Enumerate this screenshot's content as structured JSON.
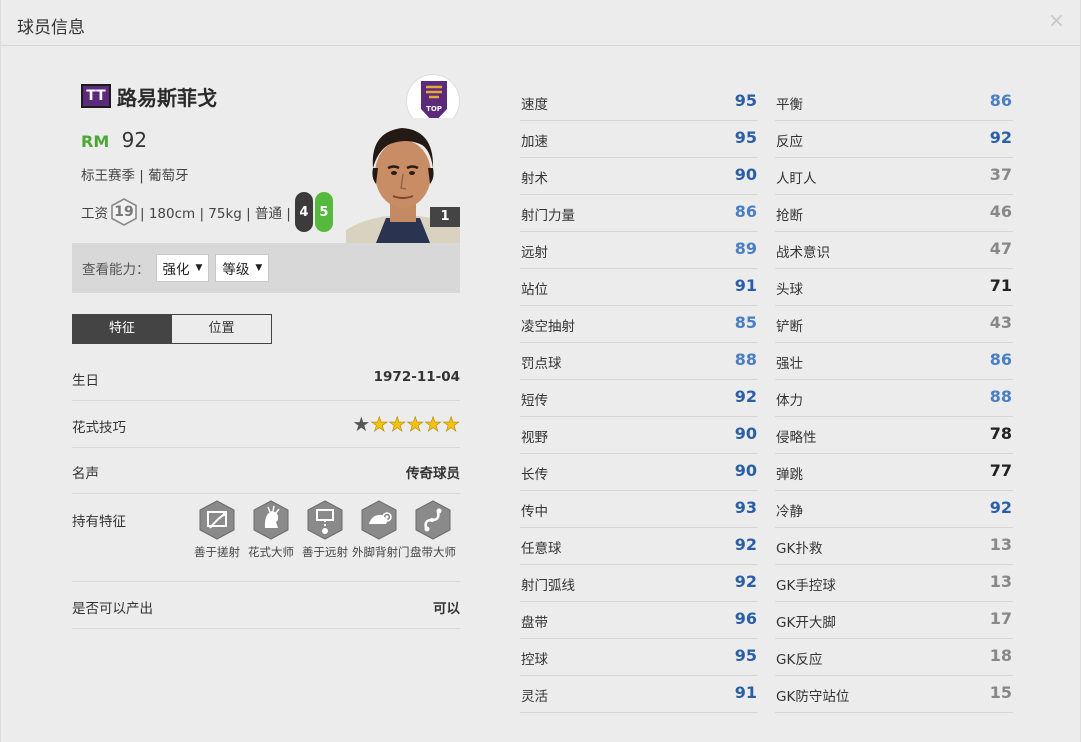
{
  "window": {
    "title": "球员信息",
    "close": "×"
  },
  "player": {
    "tag": "TT",
    "name": "路易斯菲戈",
    "position": "RM",
    "overall": "92",
    "season_nation": "标王赛季 | 葡萄牙",
    "salary_label": "工资",
    "salary": "19",
    "body": "| 180cm | 75kg | 普通 |",
    "weak_foot_left": "4",
    "weak_foot_right": "5",
    "card_level": "1",
    "club_logo_text": "TOP"
  },
  "ability": {
    "label": "查看能力：",
    "enhance": "强化",
    "level": "等级"
  },
  "tabs": [
    {
      "label": "特征"
    },
    {
      "label": "位置"
    }
  ],
  "info": {
    "birthday_label": "生日",
    "birthday": "1972-11-04",
    "skill_label": "花式技巧",
    "skill_stars": 5,
    "skill_stars_total": 6,
    "fame_label": "名声",
    "fame": "传奇球员",
    "traits_label": "持有特征",
    "traits": [
      {
        "label": "善于搓射",
        "icon": "curl-shot-icon"
      },
      {
        "label": "花式大师",
        "icon": "flair-icon"
      },
      {
        "label": "善于远射",
        "icon": "long-shot-icon"
      },
      {
        "label": "外脚背射门",
        "icon": "outside-foot-icon"
      },
      {
        "label": "盘带大师",
        "icon": "dribble-master-icon"
      }
    ],
    "produce_label": "是否可以产出",
    "produce": "可以"
  },
  "colors": {
    "high": "#2a5fa8",
    "good": "#4a7fc4",
    "mid": "#222222",
    "low": "#888888"
  },
  "stats_left": [
    {
      "name": "速度",
      "value": "95",
      "tier": "high"
    },
    {
      "name": "加速",
      "value": "95",
      "tier": "high"
    },
    {
      "name": "射术",
      "value": "90",
      "tier": "high"
    },
    {
      "name": "射门力量",
      "value": "86",
      "tier": "good"
    },
    {
      "name": "远射",
      "value": "89",
      "tier": "good"
    },
    {
      "name": "站位",
      "value": "91",
      "tier": "high"
    },
    {
      "name": "凌空抽射",
      "value": "85",
      "tier": "good"
    },
    {
      "name": "罚点球",
      "value": "88",
      "tier": "good"
    },
    {
      "name": "短传",
      "value": "92",
      "tier": "high"
    },
    {
      "name": "视野",
      "value": "90",
      "tier": "high"
    },
    {
      "name": "长传",
      "value": "90",
      "tier": "high"
    },
    {
      "name": "传中",
      "value": "93",
      "tier": "high"
    },
    {
      "name": "任意球",
      "value": "92",
      "tier": "high"
    },
    {
      "name": "射门弧线",
      "value": "92",
      "tier": "high"
    },
    {
      "name": "盘带",
      "value": "96",
      "tier": "high"
    },
    {
      "name": "控球",
      "value": "95",
      "tier": "high"
    },
    {
      "name": "灵活",
      "value": "91",
      "tier": "high"
    }
  ],
  "stats_right": [
    {
      "name": "平衡",
      "value": "86",
      "tier": "good"
    },
    {
      "name": "反应",
      "value": "92",
      "tier": "high"
    },
    {
      "name": "人盯人",
      "value": "37",
      "tier": "low"
    },
    {
      "name": "抢断",
      "value": "46",
      "tier": "low"
    },
    {
      "name": "战术意识",
      "value": "47",
      "tier": "low"
    },
    {
      "name": "头球",
      "value": "71",
      "tier": "mid"
    },
    {
      "name": "铲断",
      "value": "43",
      "tier": "low"
    },
    {
      "name": "强壮",
      "value": "86",
      "tier": "good"
    },
    {
      "name": "体力",
      "value": "88",
      "tier": "good"
    },
    {
      "name": "侵略性",
      "value": "78",
      "tier": "mid"
    },
    {
      "name": "弹跳",
      "value": "77",
      "tier": "mid"
    },
    {
      "name": "冷静",
      "value": "92",
      "tier": "high"
    },
    {
      "name": "GK扑救",
      "value": "13",
      "tier": "low"
    },
    {
      "name": "GK手控球",
      "value": "13",
      "tier": "low"
    },
    {
      "name": "GK开大脚",
      "value": "17",
      "tier": "low"
    },
    {
      "name": "GK反应",
      "value": "18",
      "tier": "low"
    },
    {
      "name": "GK防守站位",
      "value": "15",
      "tier": "low"
    }
  ]
}
